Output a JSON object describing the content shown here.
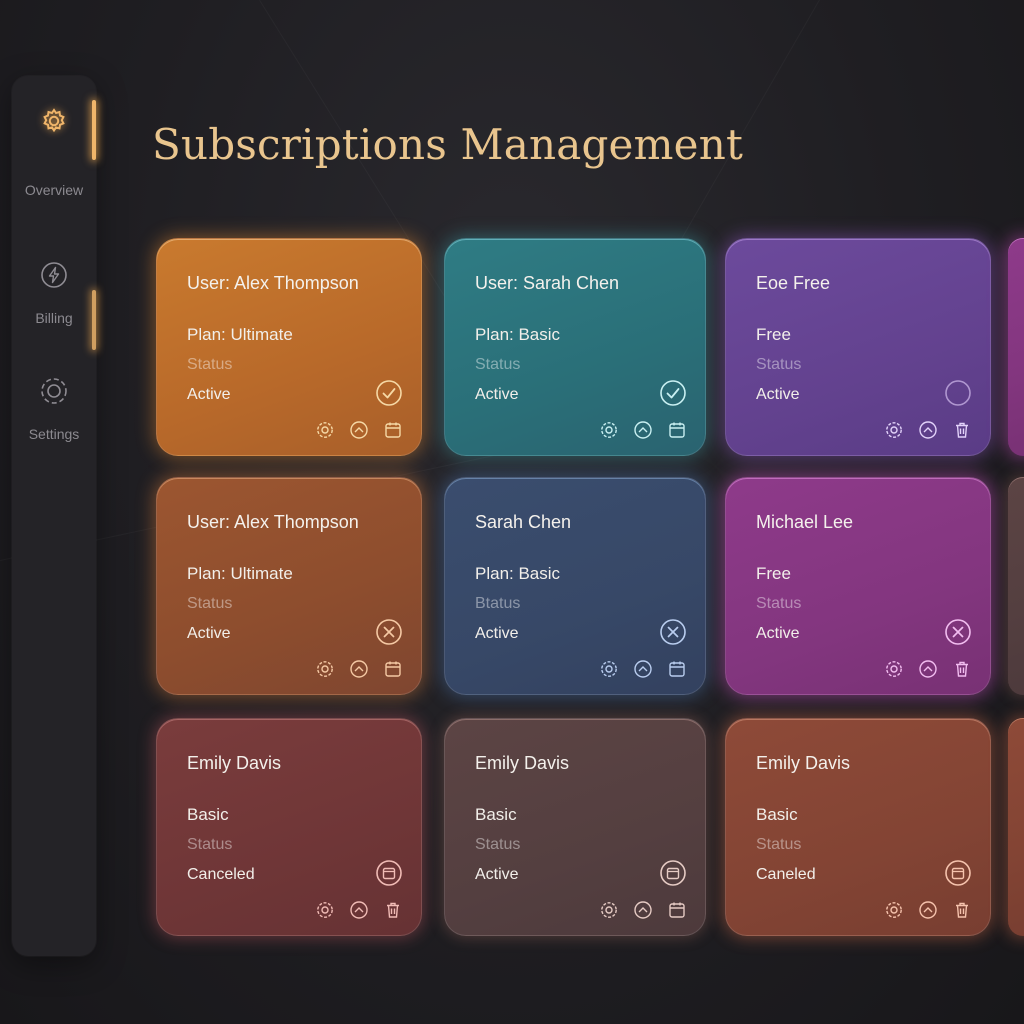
{
  "colors": {
    "background": "#1f1e22",
    "sidebar": "#242327",
    "accent": "#f0b56a",
    "title": "#e9c58e"
  },
  "sidebar": {
    "items": [
      {
        "label": "Overview",
        "icon": "gear-icon",
        "active": true
      },
      {
        "label": "Billing",
        "icon": "lightning-icon",
        "active": false
      },
      {
        "label": "Settings",
        "icon": "settings-cog-icon",
        "active": false
      }
    ]
  },
  "page": {
    "title": "Subscriptions Management"
  },
  "cards": [
    {
      "title": "User: Alex Thompson",
      "plan": "Plan: Ultimate",
      "status_label": "Status",
      "status": "Active",
      "status_icon": "check-icon",
      "color": "orange"
    },
    {
      "title": "User: Sarah Chen",
      "plan": "Plan: Basic",
      "status_label": "Status",
      "status": "Active",
      "status_icon": "check-icon",
      "color": "teal"
    },
    {
      "title": "Eoe Free",
      "plan": "Free",
      "status_label": "Status",
      "status": "Active",
      "status_icon": "empty-circle-icon",
      "color": "purple"
    },
    {
      "title": "User: Alex Thompson",
      "plan": "Plan: Ultimate",
      "status_label": "Status",
      "status": "Active",
      "status_icon": "x-icon",
      "color": "rust"
    },
    {
      "title": "Sarah Chen",
      "plan": "Plan: Basic",
      "status_label": "Btatus",
      "status": "Active",
      "status_icon": "x-icon",
      "color": "steel"
    },
    {
      "title": "Michael Lee",
      "plan": "Free",
      "status_label": "Status",
      "status": "Active",
      "status_icon": "x-icon",
      "color": "magenta"
    },
    {
      "title": "Emily Davis",
      "plan": "Basic",
      "status_label": "Status",
      "status": "Canceled",
      "status_icon": "calendar-icon",
      "color": "wine"
    },
    {
      "title": "Emily Davis",
      "plan": "Basic",
      "status_label": "Status",
      "status": "Active",
      "status_icon": "calendar-icon",
      "color": "mauve"
    },
    {
      "title": "Emily Davis",
      "plan": "Basic",
      "status_label": "Status",
      "status": "Caneled",
      "status_icon": "calendar-icon",
      "color": "brick"
    }
  ],
  "card_actions": [
    "settings-icon",
    "upgrade-icon",
    "calendar-icon"
  ]
}
